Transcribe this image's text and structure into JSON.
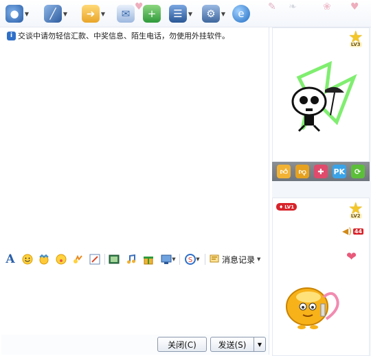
{
  "toolbar": {
    "buttons": [
      {
        "name": "video-call",
        "icon": "webcam-icon",
        "has_arrow": true
      },
      {
        "name": "voice-call",
        "icon": "microphone-icon",
        "has_arrow": true
      },
      {
        "name": "send-file",
        "icon": "folder-transfer-icon",
        "has_arrow": true
      },
      {
        "name": "send-mail",
        "icon": "envelope-icon",
        "has_arrow": false
      },
      {
        "name": "create-group",
        "icon": "add-chat-icon",
        "has_arrow": false
      },
      {
        "name": "applications",
        "icon": "users-apps-icon",
        "has_arrow": true
      },
      {
        "name": "settings",
        "icon": "gear-icon",
        "has_arrow": true
      },
      {
        "name": "browser",
        "icon": "globe-icon",
        "has_arrow": false
      }
    ]
  },
  "chat": {
    "notice": "交谈中请勿轻信汇款、中奖信息、陌生电话，勿使用外挂软件。"
  },
  "format_bar": {
    "tools": [
      "font-icon",
      "emoji-icon",
      "magic-face-icon",
      "bubble-face-icon",
      "shake-window-icon",
      "doodle-icon",
      "image-icon",
      "music-icon",
      "gift-box-icon",
      "screenshot-icon",
      "sogou-input-icon"
    ],
    "message_record_label": "消息记录"
  },
  "bottom": {
    "close_label": "关闭(C)",
    "send_label": "发送(S)"
  },
  "side": {
    "top_level_label": "LV3",
    "bottom_level_label": "LV2",
    "lv1_label": "LV1",
    "volume_count": "44",
    "action_icons": [
      "thumbs-up-icon",
      "thumbs-down-icon",
      "gift-icon",
      "pk-icon",
      "refresh-icon"
    ]
  },
  "colors": {
    "accent": "#2f6fc8",
    "badge_red": "#d8232a",
    "star_gold": "#f3c629"
  }
}
